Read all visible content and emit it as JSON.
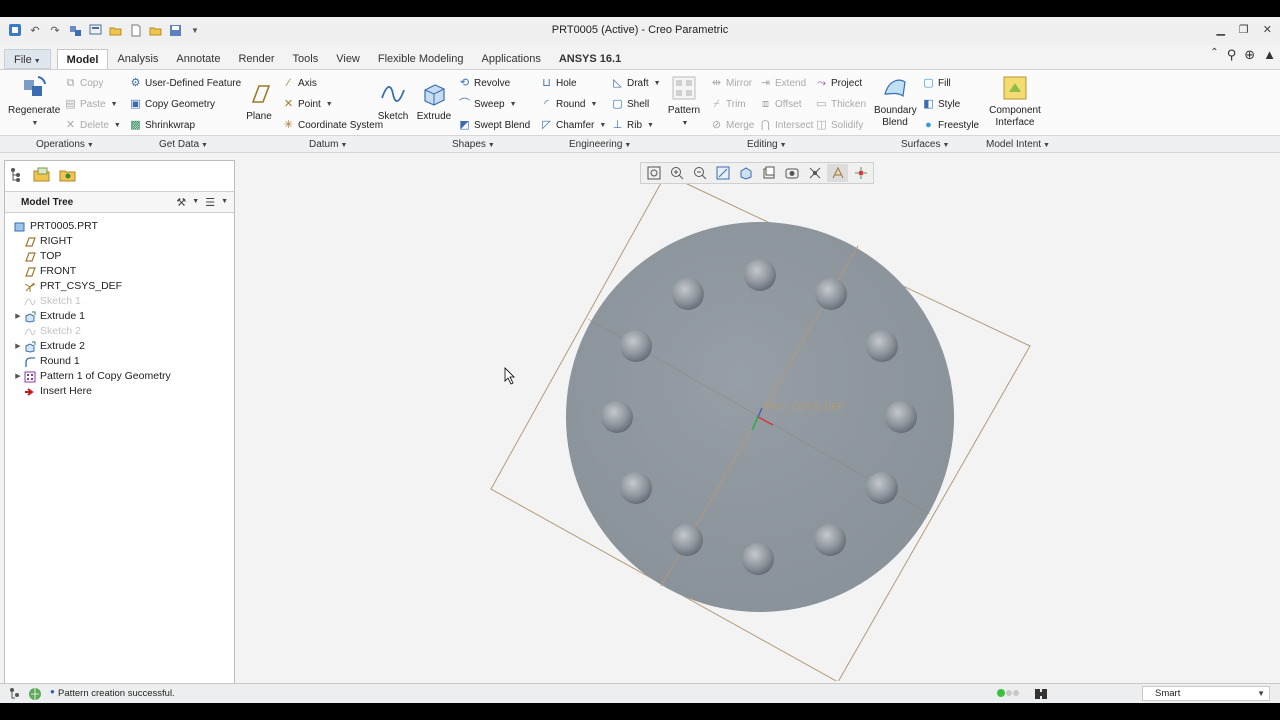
{
  "window": {
    "title": "PRT0005 (Active) - Creo Parametric",
    "controls": [
      "minimize-icon",
      "restore-icon",
      "close-icon"
    ]
  },
  "tabs": [
    {
      "label": "File",
      "name": "file"
    },
    {
      "label": "Model",
      "name": "model",
      "active": true
    },
    {
      "label": "Analysis",
      "name": "analysis"
    },
    {
      "label": "Annotate",
      "name": "annotate"
    },
    {
      "label": "Render",
      "name": "render"
    },
    {
      "label": "Tools",
      "name": "tools"
    },
    {
      "label": "View",
      "name": "view"
    },
    {
      "label": "Flexible Modeling",
      "name": "flexible-modeling"
    },
    {
      "label": "Applications",
      "name": "applications"
    },
    {
      "label": "ANSYS 16.1",
      "name": "ansys"
    }
  ],
  "ribbon": {
    "regenerate": "Regenerate",
    "copy": "Copy",
    "paste": "Paste",
    "delete": "Delete",
    "user_defined_feature": "User-Defined Feature",
    "copy_geometry": "Copy Geometry",
    "shrinkwrap": "Shrinkwrap",
    "plane": "Plane",
    "axis": "Axis",
    "point": "Point",
    "coordinate_system": "Coordinate System",
    "sketch": "Sketch",
    "extrude": "Extrude",
    "revolve": "Revolve",
    "sweep": "Sweep",
    "swept_blend": "Swept Blend",
    "hole": "Hole",
    "round": "Round",
    "chamfer": "Chamfer",
    "draft": "Draft",
    "shell": "Shell",
    "rib": "Rib",
    "pattern": "Pattern",
    "mirror": "Mirror",
    "extend": "Extend",
    "project": "Project",
    "trim": "Trim",
    "offset": "Offset",
    "thicken": "Thicken",
    "merge": "Merge",
    "intersect": "Intersect",
    "solidify": "Solidify",
    "boundary_blend_1": "Boundary",
    "boundary_blend_2": "Blend",
    "fill": "Fill",
    "style": "Style",
    "freestyle": "Freestyle",
    "component_interface_1": "Component",
    "component_interface_2": "Interface"
  },
  "groups": {
    "operations": "Operations",
    "get_data": "Get Data",
    "datum": "Datum",
    "shapes": "Shapes",
    "engineering": "Engineering",
    "editing": "Editing",
    "surfaces": "Surfaces",
    "model_intent": "Model Intent"
  },
  "model_tree": {
    "header": "Model Tree",
    "items": [
      {
        "label": "PRT0005.PRT",
        "icon": "part-icon",
        "expander": false,
        "dim": false
      },
      {
        "label": "RIGHT",
        "icon": "datum-plane-icon",
        "expander": false,
        "dim": false
      },
      {
        "label": "TOP",
        "icon": "datum-plane-icon",
        "expander": false,
        "dim": false
      },
      {
        "label": "FRONT",
        "icon": "datum-plane-icon",
        "expander": false,
        "dim": false
      },
      {
        "label": "PRT_CSYS_DEF",
        "icon": "csys-icon",
        "expander": false,
        "dim": false
      },
      {
        "label": "Sketch 1",
        "icon": "sketch-icon",
        "expander": false,
        "dim": true
      },
      {
        "label": "Extrude 1",
        "icon": "extrude-icon",
        "expander": true,
        "dim": false
      },
      {
        "label": "Sketch 2",
        "icon": "sketch-icon",
        "expander": false,
        "dim": true
      },
      {
        "label": "Extrude 2",
        "icon": "extrude-icon",
        "expander": true,
        "dim": false
      },
      {
        "label": "Round 1",
        "icon": "round-icon",
        "expander": false,
        "dim": false
      },
      {
        "label": "Pattern 1 of Copy Geometry",
        "icon": "pattern-icon",
        "expander": true,
        "dim": false
      },
      {
        "label": "Insert Here",
        "icon": "insert-arrow-icon",
        "expander": false,
        "dim": false
      }
    ]
  },
  "viewport": {
    "csys_label": "PRT_CSYS_DEF",
    "view_tools": [
      "refit-icon",
      "zoom-in-icon",
      "zoom-out-icon",
      "repaint-icon",
      "display-style-icon",
      "saved-views-icon",
      "view-manager-icon",
      "perspective-icon",
      "datum-display-icon",
      "annotation-display-icon",
      "spin-center-icon"
    ]
  },
  "status": {
    "message": "Pattern creation successful.",
    "filter": "Smart"
  },
  "colors": {
    "model_fill": "#8f979f",
    "datum_line": "#b49a78",
    "accent": "#2c5ea8"
  }
}
